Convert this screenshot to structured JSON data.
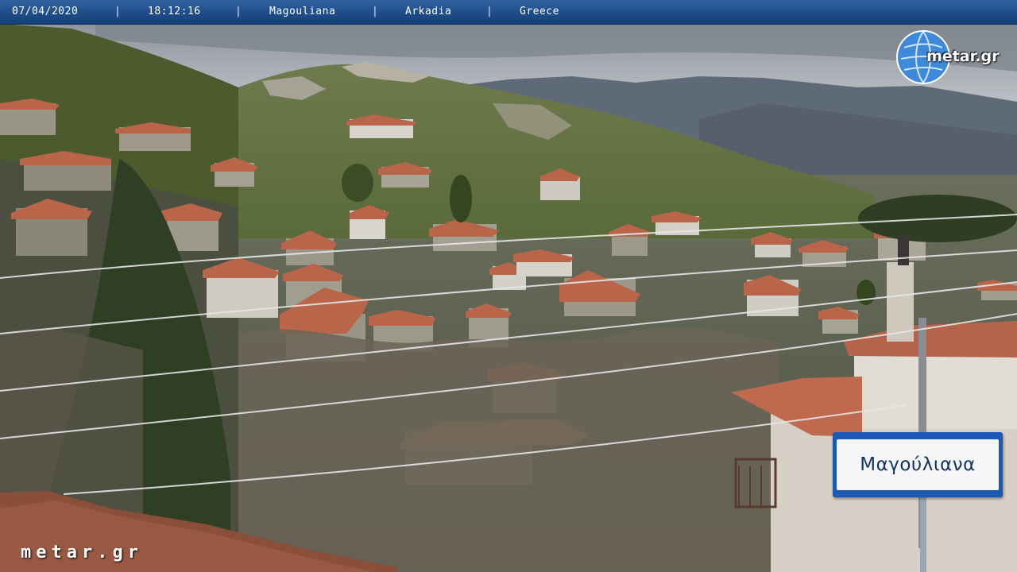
{
  "camera_overlay": {
    "date": "07/04/2020",
    "time": "18:12:16",
    "village": "Magouliana",
    "region": "Arkadia",
    "country": "Greece",
    "separator": "|"
  },
  "watermark": {
    "text": "metar.gr"
  },
  "logo": {
    "text": "metar.gr",
    "icon": "globe-icon"
  },
  "sign": {
    "text": "Μαγούλιανα"
  },
  "colors": {
    "bar_blue": "#1f4d8a",
    "sky": "#c9ced3",
    "mountain": "#5f6a78",
    "roof": "#b9654a",
    "foliage": "#5d6a3a",
    "sign_blue": "#1c58b5",
    "sign_white": "#f4f6f8"
  }
}
